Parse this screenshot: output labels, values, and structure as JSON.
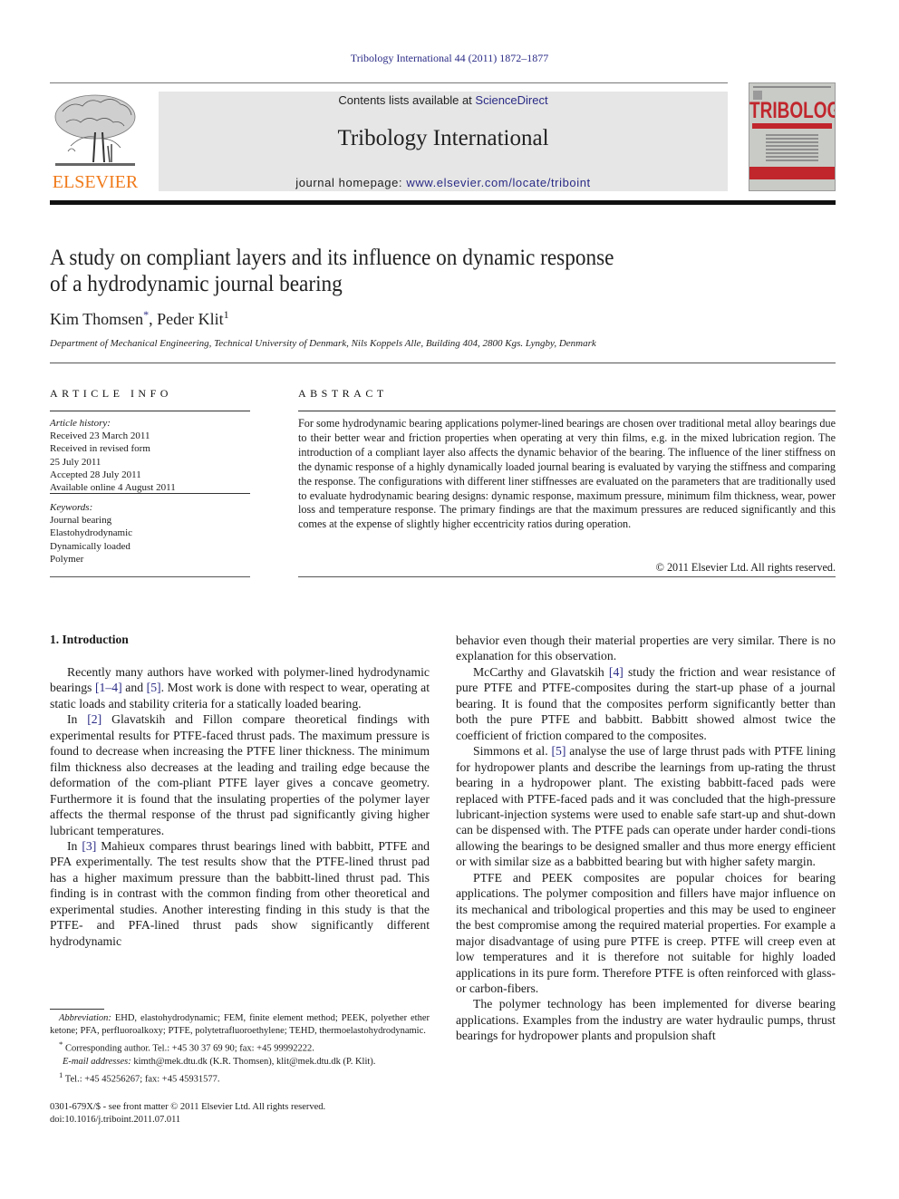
{
  "running_head": "Tribology International 44 (2011) 1872–1877",
  "header": {
    "publisher": "ELSEVIER",
    "contents_prefix": "Contents lists available at ",
    "contents_link": "ScienceDirect",
    "journal_title": "Tribology International",
    "homepage_prefix": "journal homepage: ",
    "homepage_link": "www.elsevier.com/locate/triboint",
    "cover_title": "TRIBOLOGY",
    "colors": {
      "link": "#2a2a86",
      "elsevier_orange": "#f07a1a",
      "cover_red": "#c0262c",
      "masthead_bg": "#e6e6e6"
    }
  },
  "article": {
    "title_line1": "A study on compliant layers and its influence on dynamic response",
    "title_line2": "of a hydrodynamic journal bearing",
    "author1": "Kim Thomsen",
    "author1_mark": "*",
    "author_sep": ", ",
    "author2": "Peder Klit",
    "author2_mark": "1",
    "affiliation": "Department of Mechanical Engineering, Technical University of Denmark, Nils Koppels Alle, Building 404, 2800 Kgs. Lyngby, Denmark"
  },
  "article_info": {
    "heading": "ARTICLE INFO",
    "history_label": "Article history:",
    "history": [
      "Received 23 March 2011",
      "Received in revised form",
      "25 July 2011",
      "Accepted 28 July 2011",
      "Available online 4 August 2011"
    ],
    "keywords_label": "Keywords:",
    "keywords": [
      "Journal bearing",
      "Elastohydrodynamic",
      "Dynamically loaded",
      "Polymer"
    ]
  },
  "abstract": {
    "heading": "ABSTRACT",
    "text": "For some hydrodynamic bearing applications polymer-lined bearings are chosen over traditional metal alloy bearings due to their better wear and friction properties when operating at very thin films, e.g. in the mixed lubrication region. The introduction of a compliant layer also affects the dynamic behavior of the bearing. The influence of the liner stiffness on the dynamic response of a highly dynamically loaded journal bearing is evaluated by varying the stiffness and comparing the response. The configurations with different liner stiffnesses are evaluated on the parameters that are traditionally used to evaluate hydrodynamic bearing designs: dynamic response, maximum pressure, minimum film thickness, wear, power loss and temperature response. The primary findings are that the maximum pressures are reduced significantly and this comes at the expense of slightly higher eccentricity ratios during operation.",
    "copyright": "© 2011 Elsevier Ltd. All rights reserved."
  },
  "body": {
    "section1_heading": "1.  Introduction",
    "left": {
      "p1": [
        "Recently many authors have worked with polymer-lined hydrodynamic bearings ",
        "[1–4]",
        " and ",
        "[5]",
        ". Most work is done with respect to wear, operating at static loads and stability criteria for a statically loaded bearing."
      ],
      "p2": [
        "In ",
        "[2]",
        " Glavatskih and Fillon compare theoretical findings with experimental results for PTFE-faced thrust pads. The maximum pressure is found to decrease when increasing the PTFE liner thickness. The minimum film thickness also decreases at the leading and trailing edge because the deformation of the com-pliant PTFE layer gives a concave geometry. Furthermore it is found that the insulating properties of the polymer layer affects the thermal response of the thrust pad significantly giving higher lubricant temperatures."
      ],
      "p3": [
        "In ",
        "[3]",
        " Mahieux compares thrust bearings lined with babbitt, PTFE and PFA experimentally. The test results show that the PTFE-lined thrust pad has a higher maximum pressure than the babbitt-lined thrust pad. This finding is in contrast with the common finding from other theoretical and experimental studies. Another interesting finding in this study is that the PTFE- and PFA-lined thrust pads show significantly different hydrodynamic"
      ]
    },
    "right": {
      "p0": "behavior even though their material properties are very similar. There is no explanation for this observation.",
      "p1": [
        "McCarthy and Glavatskih ",
        "[4]",
        " study the friction and wear resistance of pure PTFE and PTFE-composites during the start-up phase of a journal bearing. It is found that the composites perform significantly better than both the pure PTFE and babbitt. Babbitt showed almost twice the coefficient of friction compared to the composites."
      ],
      "p2": [
        "Simmons et al. ",
        "[5]",
        " analyse the use of large thrust pads with PTFE lining for hydropower plants and describe the learnings from up-rating the thrust bearing in a hydropower plant. The existing babbitt-faced pads were replaced with PTFE-faced pads and it was concluded that the high-pressure lubricant-injection systems were used to enable safe start-up and shut-down can be dispensed with. The PTFE pads can operate under harder condi-tions allowing the bearings to be designed smaller and thus more energy efficient or with similar size as a babbitted bearing but with higher safety margin."
      ],
      "p3": "PTFE and PEEK composites are popular choices for bearing applications. The polymer composition and fillers have major influence on its mechanical and tribological properties and this may be used to engineer the best compromise among the required material properties. For example a major disadvantage of using pure PTFE is creep. PTFE will creep even at low temperatures and it is therefore not suitable for highly loaded applications in its pure form. Therefore PTFE is often reinforced with glass- or carbon-fibers.",
      "p4": "The polymer technology has been implemented for diverse bearing applications. Examples from the industry are water hydraulic pumps, thrust bearings for hydropower plants and propulsion shaft"
    }
  },
  "footnotes": {
    "abbrev_label": "Abbreviation:",
    "abbrev_text": " EHD, elastohydrodynamic; FEM, finite element method; PEEK, polyether ether ketone; PFA, perfluoroalkoxy; PTFE, polytetrafluoroethylene; TEHD, thermoelastohydrodynamic.",
    "corr_mark": "*",
    "corr_text": " Corresponding author. Tel.: +45 30 37 69 90; fax: +45 99992222.",
    "email_label": "E-mail addresses:",
    "email_text": " kimth@mek.dtu.dk (K.R. Thomsen), klit@mek.dtu.dk (P. Klit).",
    "note1_mark": "1",
    "note1_text": "  Tel.: +45 45256267; fax: +45 45931577."
  },
  "front_matter": {
    "line1": "0301-679X/$ - see front matter © 2011 Elsevier Ltd. All rights reserved.",
    "doi": "doi:10.1016/j.triboint.2011.07.011"
  }
}
